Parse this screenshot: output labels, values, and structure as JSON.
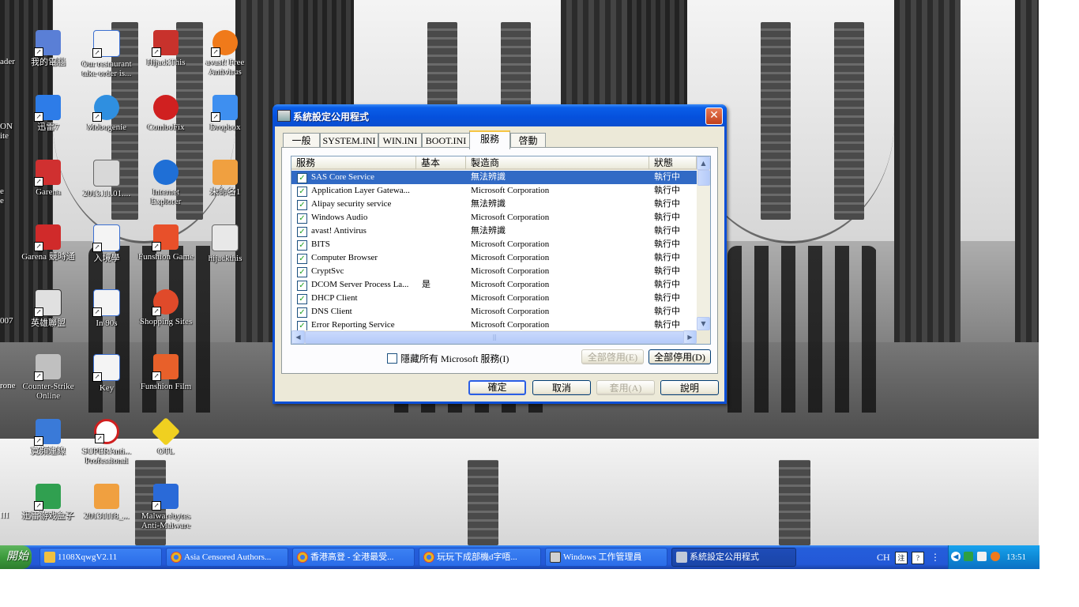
{
  "desktop": {
    "edge_labels": [
      "ader",
      "ON",
      "ite",
      "e",
      "e",
      "007",
      "rone",
      "III"
    ],
    "icons": [
      {
        "label": "我的電腦",
        "icon": "computer-icon",
        "color": "#5a7fd6"
      },
      {
        "label": "Our restaurant take order is...",
        "icon": "word-doc-icon",
        "color": "#3b6fd0"
      },
      {
        "label": "HijackThis",
        "icon": "hijackthis-icon",
        "color": "#c8322c"
      },
      {
        "label": "avast! Free Antivirus",
        "icon": "avast-icon",
        "color": "#f07a1a"
      },
      {
        "label": "迅雷7",
        "icon": "thunder-icon",
        "color": "#2d7ce8"
      },
      {
        "label": "Mobogenie",
        "icon": "mobogenie-icon",
        "color": "#2f8fe0"
      },
      {
        "label": "ComboFix",
        "icon": "combofix-icon",
        "color": "#d02020"
      },
      {
        "label": "Dropbox",
        "icon": "dropbox-icon",
        "color": "#3e8ff0"
      },
      {
        "label": "Garena",
        "icon": "garena-icon",
        "color": "#d03030"
      },
      {
        "label": "2013.11.01....",
        "icon": "video-file-icon",
        "color": "#d8d8d8"
      },
      {
        "label": "Internet Explorer",
        "icon": "ie-icon",
        "color": "#1f6fd6"
      },
      {
        "label": "未命名1",
        "icon": "document-icon",
        "color": "#f0a040"
      },
      {
        "label": "Garena 競時通",
        "icon": "garena-chat-icon",
        "color": "#d02a2a"
      },
      {
        "label": "入境學",
        "icon": "word-doc-icon",
        "color": "#3b6fd0"
      },
      {
        "label": "Funshion Game",
        "icon": "funshion-game-icon",
        "color": "#e8502a"
      },
      {
        "label": "hijackthis",
        "icon": "text-file-icon",
        "color": "#e8e8e8"
      },
      {
        "label": "英雄聯盟",
        "icon": "lol-icon",
        "color": "#e0e0e0"
      },
      {
        "label": "In 90s",
        "icon": "word-doc-icon",
        "color": "#3b6fd0"
      },
      {
        "label": "Shopping Sites",
        "icon": "shopping-icon",
        "color": "#e04a2a"
      },
      {
        "label": "Counter-Strike Online",
        "icon": "counter-strike-icon",
        "color": "#c0c0c0"
      },
      {
        "label": "Key",
        "icon": "word-doc-icon",
        "color": "#3b6fd0"
      },
      {
        "label": "Funshion Film",
        "icon": "funshion-film-icon",
        "color": "#e8602a"
      },
      {
        "label": "寬頻連線",
        "icon": "broadband-icon",
        "color": "#3a7ad8"
      },
      {
        "label": "SUPERAnti... Professional",
        "icon": "superantispyware-icon",
        "color": "#d02020"
      },
      {
        "label": "OTL",
        "icon": "otl-icon",
        "color": "#f0d020"
      },
      {
        "label": "迅雷游戏盒子",
        "icon": "game-box-icon",
        "color": "#30a050"
      },
      {
        "label": "20131118_...",
        "icon": "image-file-icon",
        "color": "#f0a040"
      },
      {
        "label": "Malwarebytes Anti-Malware",
        "icon": "malwarebytes-icon",
        "color": "#2a6ad8"
      }
    ]
  },
  "dialog": {
    "title": "系統設定公用程式",
    "tabs": [
      {
        "label": "一般",
        "active": false
      },
      {
        "label": "SYSTEM.INI",
        "active": false
      },
      {
        "label": "WIN.INI",
        "active": false
      },
      {
        "label": "BOOT.INI",
        "active": false
      },
      {
        "label": "服務",
        "active": true
      },
      {
        "label": "啓動",
        "active": false
      }
    ],
    "columns": [
      "服務",
      "基本",
      "製造商",
      "狀態"
    ],
    "services": [
      {
        "name": "SAS Core Service",
        "essential": "",
        "manufacturer": "無法辨識",
        "status": "執行中",
        "checked": true,
        "selected": true
      },
      {
        "name": "Application Layer Gatewa...",
        "essential": "",
        "manufacturer": "Microsoft Corporation",
        "status": "執行中",
        "checked": true,
        "selected": false
      },
      {
        "name": "Alipay security service",
        "essential": "",
        "manufacturer": "無法辨識",
        "status": "執行中",
        "checked": true,
        "selected": false
      },
      {
        "name": "Windows Audio",
        "essential": "",
        "manufacturer": "Microsoft Corporation",
        "status": "執行中",
        "checked": true,
        "selected": false
      },
      {
        "name": "avast! Antivirus",
        "essential": "",
        "manufacturer": "無法辨識",
        "status": "執行中",
        "checked": true,
        "selected": false
      },
      {
        "name": "BITS",
        "essential": "",
        "manufacturer": "Microsoft Corporation",
        "status": "執行中",
        "checked": true,
        "selected": false
      },
      {
        "name": "Computer Browser",
        "essential": "",
        "manufacturer": "Microsoft Corporation",
        "status": "執行中",
        "checked": true,
        "selected": false
      },
      {
        "name": "CryptSvc",
        "essential": "",
        "manufacturer": "Microsoft Corporation",
        "status": "執行中",
        "checked": true,
        "selected": false
      },
      {
        "name": "DCOM Server Process La...",
        "essential": "是",
        "manufacturer": "Microsoft Corporation",
        "status": "執行中",
        "checked": true,
        "selected": false
      },
      {
        "name": "DHCP Client",
        "essential": "",
        "manufacturer": "Microsoft Corporation",
        "status": "執行中",
        "checked": true,
        "selected": false
      },
      {
        "name": "DNS Client",
        "essential": "",
        "manufacturer": "Microsoft Corporation",
        "status": "執行中",
        "checked": true,
        "selected": false
      },
      {
        "name": "Error Reporting Service",
        "essential": "",
        "manufacturer": "Microsoft Corporation",
        "status": "執行中",
        "checked": true,
        "selected": false
      }
    ],
    "hide_ms_label": "隱藏所有 Microsoft 服務(I)",
    "hide_ms_checked": false,
    "enable_all_label": "全部啓用(E)",
    "disable_all_label": "全部停用(D)",
    "ok_label": "確定",
    "cancel_label": "取消",
    "apply_label": "套用(A)",
    "help_label": "說明",
    "close_glyph": "✕"
  },
  "taskbar": {
    "start_label": "開始",
    "tasks": [
      {
        "label": "1108XqwgV2.11",
        "icon": "folder-icon",
        "color": "#f0c040",
        "active": false
      },
      {
        "label": "Asia Censored Authors...",
        "icon": "chrome-icon",
        "color": "#e8b020",
        "active": false
      },
      {
        "label": "香港高登 - 全港最受...",
        "icon": "chrome-icon",
        "color": "#e8b020",
        "active": false
      },
      {
        "label": "玩玩下成部機d字唔...",
        "icon": "chrome-icon",
        "color": "#e8b020",
        "active": false
      },
      {
        "label": "Windows 工作管理員",
        "icon": "task-manager-icon",
        "color": "#d0d0d0",
        "active": false
      },
      {
        "label": "系統設定公用程式",
        "icon": "msconfig-icon",
        "color": "#c0c8d8",
        "active": true
      }
    ],
    "language": "CH",
    "clock": "13:51"
  },
  "colors": {
    "selection": "#316ac5",
    "title_blue": "#0550dc",
    "dialog_face": "#ece9d8",
    "taskbar_blue": "#245edb",
    "tray_blue": "#0e8ad6"
  }
}
